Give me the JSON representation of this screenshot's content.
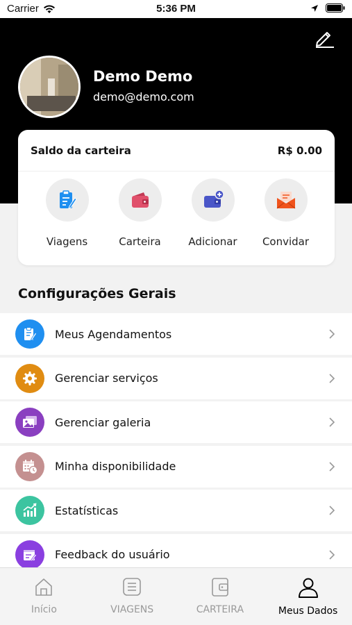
{
  "status_bar": {
    "carrier": "Carrier",
    "time": "5:36 PM"
  },
  "profile": {
    "name": "Demo Demo",
    "email": "demo@demo.com"
  },
  "wallet": {
    "label": "Saldo da carteira",
    "amount": "R$ 0.00"
  },
  "quick_actions": [
    {
      "label": "Viagens",
      "icon": "clipboard-edit-icon",
      "color": "#1f8ff0"
    },
    {
      "label": "Carteira",
      "icon": "wallet-icon",
      "color": "#e0506b"
    },
    {
      "label": "Adicionar",
      "icon": "wallet-add-icon",
      "color": "#4a56c8"
    },
    {
      "label": "Convidar",
      "icon": "envelope-invite-icon",
      "color": "#f0531c"
    }
  ],
  "settings": {
    "title": "Configurações Gerais",
    "items": [
      {
        "label": "Meus Agendamentos",
        "icon": "clipboard-edit-icon",
        "color": "#1f8ff0"
      },
      {
        "label": "Gerenciar serviços",
        "icon": "gear-icon",
        "color": "#e08c12"
      },
      {
        "label": "Gerenciar galeria",
        "icon": "gallery-icon",
        "color": "#8a3fc0"
      },
      {
        "label": "Minha disponibilidade",
        "icon": "calendar-clock-icon",
        "color": "#c49090"
      },
      {
        "label": "Estatísticas",
        "icon": "bar-chart-icon",
        "color": "#3cc4a0"
      },
      {
        "label": "Feedback do usuário",
        "icon": "feedback-form-icon",
        "color": "#8a3fe0"
      }
    ]
  },
  "tabs": [
    {
      "label": "Início",
      "icon": "home-icon",
      "active": false
    },
    {
      "label": "VIAGENS",
      "icon": "list-icon",
      "active": false
    },
    {
      "label": "CARTEIRA",
      "icon": "wallet-icon",
      "active": false
    },
    {
      "label": "Meus Dados",
      "icon": "user-icon",
      "active": true
    }
  ]
}
